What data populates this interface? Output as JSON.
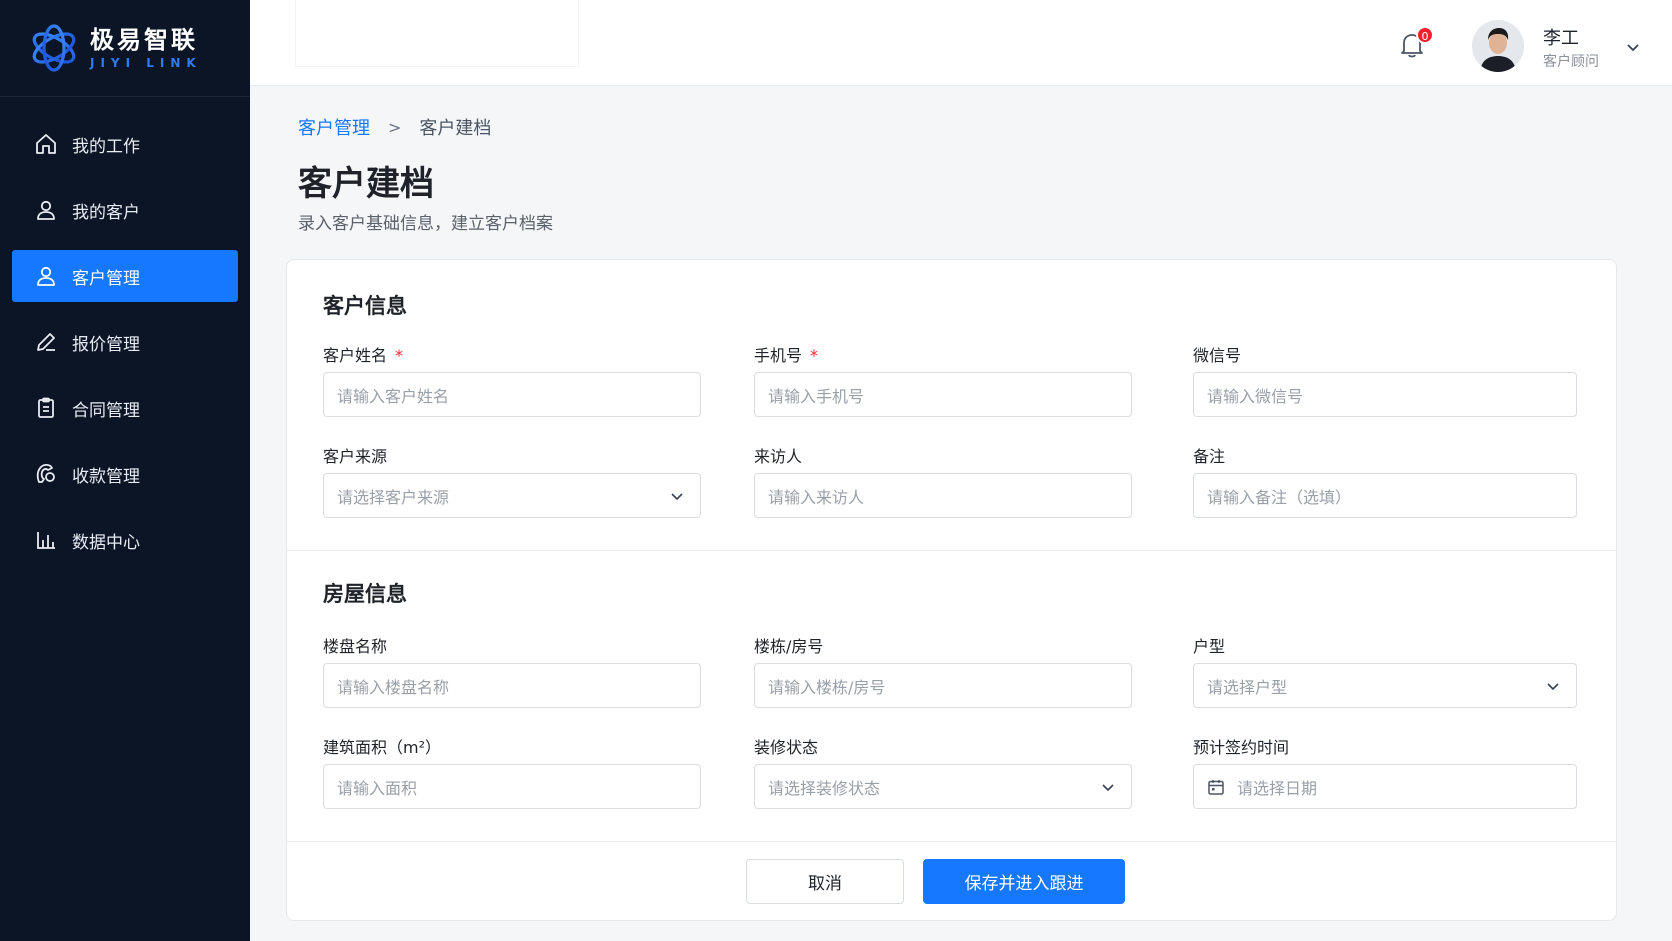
{
  "brand": {
    "name": "极易智联",
    "sub": "JIYI LINK"
  },
  "sidebar": {
    "items": [
      {
        "label": "我的工作",
        "icon": "home-icon"
      },
      {
        "label": "我的客户",
        "icon": "user-icon"
      },
      {
        "label": "客户管理",
        "icon": "user-icon",
        "active": true
      },
      {
        "label": "报价管理",
        "icon": "pen-icon"
      },
      {
        "label": "合同管理",
        "icon": "clipboard-icon"
      },
      {
        "label": "收款管理",
        "icon": "wallet-icon"
      },
      {
        "label": "数据中心",
        "icon": "bar-chart-icon"
      }
    ]
  },
  "header": {
    "notification_count": "0",
    "user": {
      "name": "李工",
      "role": "客户顾问"
    }
  },
  "breadcrumb": {
    "parent": "客户管理",
    "separator": ">",
    "current": "客户建档"
  },
  "page": {
    "title": "客户建档",
    "description": "录入客户基础信息，建立客户档案"
  },
  "form": {
    "customer_section": {
      "title": "客户信息",
      "fields": {
        "name": {
          "label": "客户姓名",
          "required": "*",
          "placeholder": "请输入客户姓名"
        },
        "phone": {
          "label": "手机号",
          "required": "*",
          "placeholder": "请输入手机号"
        },
        "wechat": {
          "label": "微信号",
          "placeholder": "请输入微信号"
        },
        "source": {
          "label": "客户来源",
          "placeholder": "请选择客户来源"
        },
        "visitor": {
          "label": "来访人",
          "placeholder": "请输入来访人"
        },
        "remark": {
          "label": "备注",
          "placeholder": "请输入备注（选填）"
        }
      }
    },
    "house_section": {
      "title": "房屋信息",
      "fields": {
        "estate": {
          "label": "楼盘名称",
          "placeholder": "请输入楼盘名称"
        },
        "building": {
          "label": "楼栋/房号",
          "placeholder": "请输入楼栋/房号"
        },
        "layout": {
          "label": "户型",
          "placeholder": "请选择户型"
        },
        "area": {
          "label": "建筑面积（m²）",
          "placeholder": "请输入面积"
        },
        "decoration": {
          "label": "装修状态",
          "placeholder": "请选择装修状态"
        },
        "sign_date": {
          "label": "预计签约时间",
          "placeholder": "请选择日期"
        }
      }
    },
    "actions": {
      "cancel": "取消",
      "save": "保存并进入跟进"
    }
  },
  "colors": {
    "primary": "#1677ff",
    "sidebar_bg": "#0b1526",
    "required": "#f5222d"
  }
}
